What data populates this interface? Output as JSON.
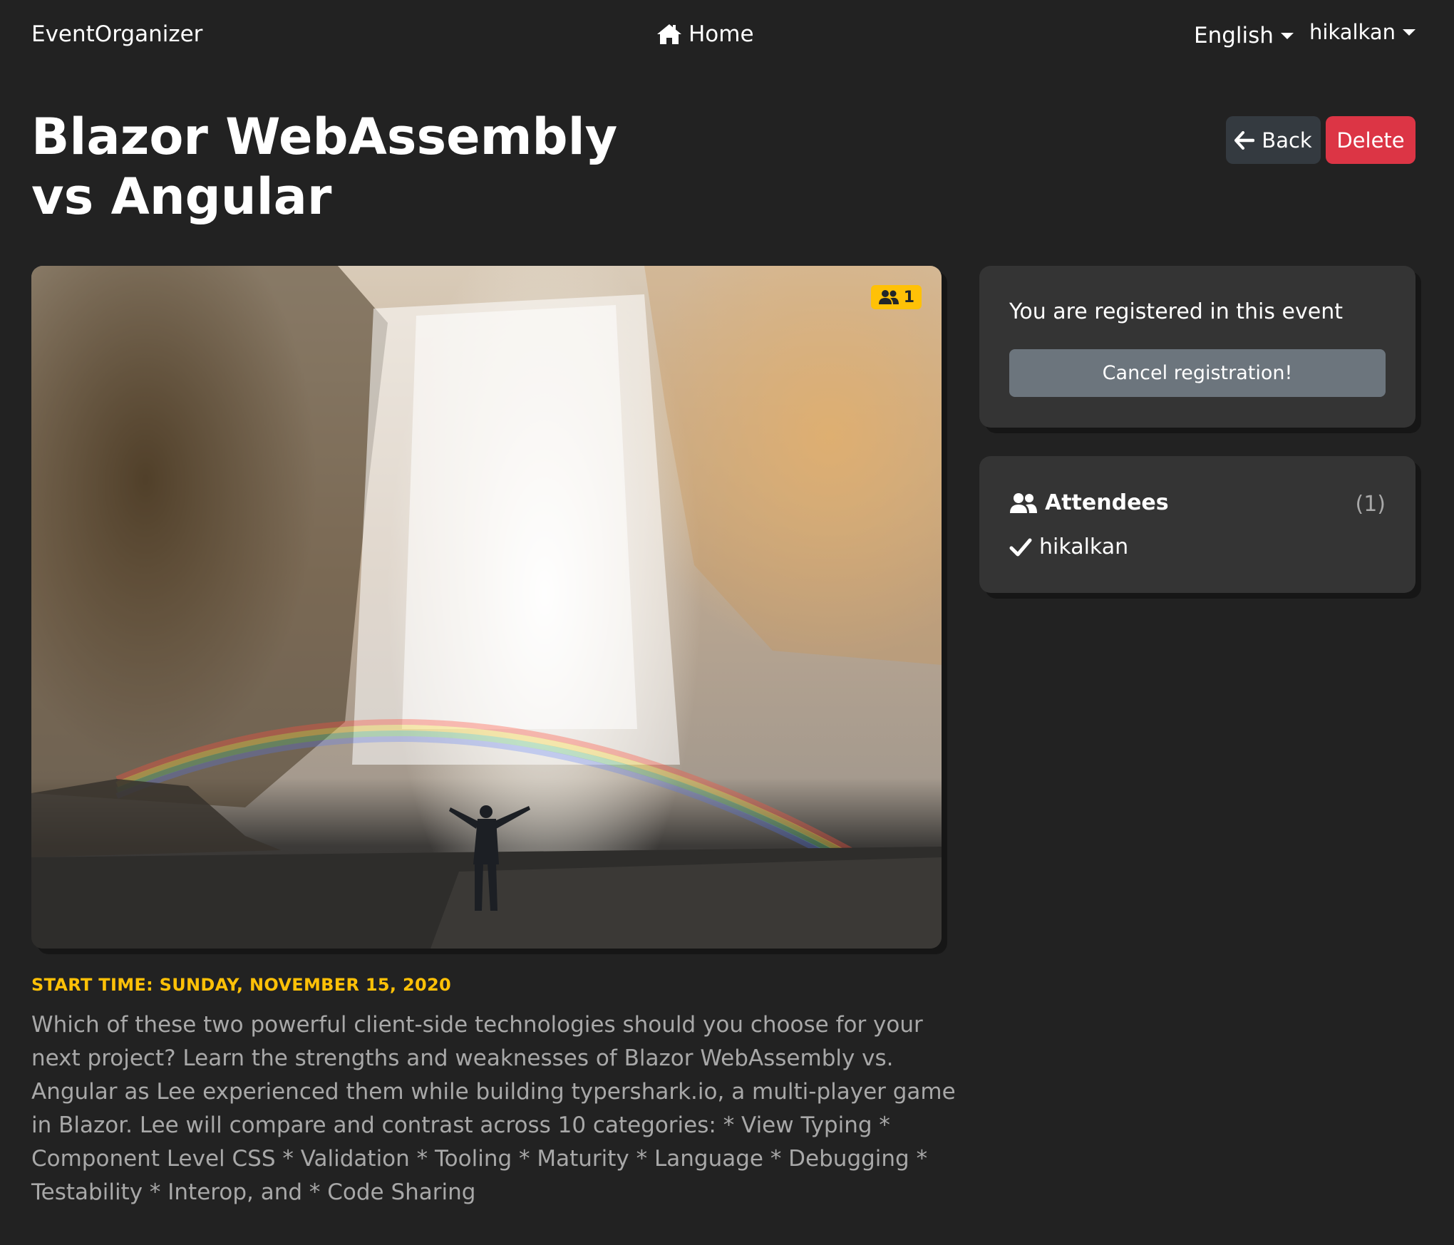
{
  "navbar": {
    "brand": "EventOrganizer",
    "home_label": "Home",
    "home_icon": "home-icon",
    "language": "English",
    "user": "hikalkan"
  },
  "event": {
    "title": "Blazor WebAssembly vs Angular",
    "back_label": "Back",
    "delete_label": "Delete",
    "attendee_badge_count": "1",
    "start_time": "START TIME: SUNDAY, NOVEMBER 15, 2020",
    "description": "Which of these two powerful client-side technologies should you choose for your next project? Learn the strengths and weaknesses of Blazor WebAssembly vs. Angular as Lee experienced them while building typershark.io, a multi-player game in Blazor. Lee will compare and contrast across 10 categories: * View Typing * Component Level CSS * Validation * Tooling * Maturity * Language * Debugging * Testability * Interop, and * Code Sharing"
  },
  "registration": {
    "status_text": "You are registered in this event",
    "cancel_label": "Cancel registration!"
  },
  "attendees": {
    "heading": "Attendees",
    "count": "(1)",
    "items": [
      {
        "name": "hikalkan"
      }
    ]
  },
  "colors": {
    "background": "#222222",
    "card": "#343434",
    "danger": "#dc3545",
    "secondary": "#6c757d",
    "warning": "#ffc107"
  }
}
